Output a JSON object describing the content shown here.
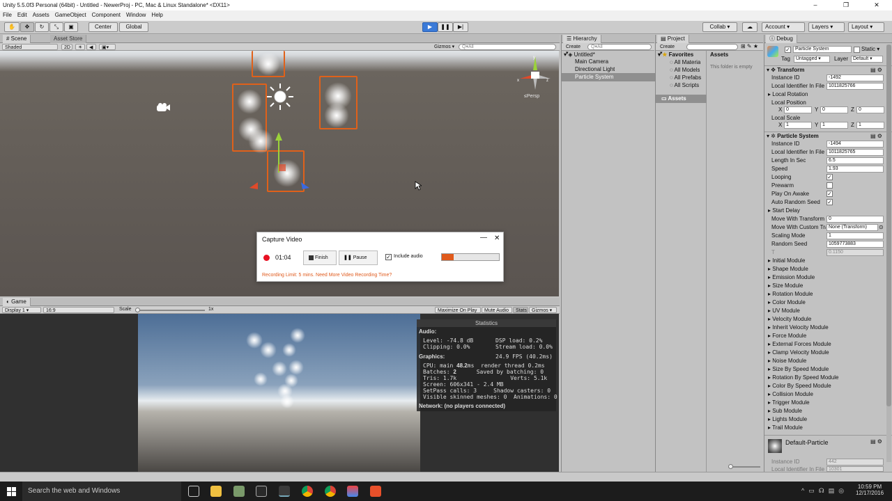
{
  "window": {
    "title": "Unity 5.5.0f3 Personal (64bit) - Untitled - NewerProj - PC, Mac & Linux Standalone* <DX11>",
    "minimize": "–",
    "maximize": "❐",
    "close": "✕"
  },
  "menu": [
    "File",
    "Edit",
    "Assets",
    "GameObject",
    "Component",
    "Window",
    "Help"
  ],
  "toolbar": {
    "center": "Center",
    "global": "Global",
    "collab": "Collab ▾",
    "account": "Account",
    "layers": "Layers",
    "layout": "Layout"
  },
  "scene": {
    "tab_scene": "Scene",
    "tab_store": "Asset Store",
    "shading": "Shaded",
    "mode2d": "2D",
    "gizmos": "Gizmos ▾",
    "search": "Q▾All",
    "persp": "≤Persp"
  },
  "game": {
    "tab": "Game",
    "display": "Display 1",
    "aspect": "16:9",
    "scale_label": "Scale",
    "scale_value": "1x",
    "max_on_play": "Maximize On Play",
    "mute": "Mute Audio",
    "stats": "Stats",
    "gizmos": "Gizmos ▾"
  },
  "stats": {
    "title": "Statistics",
    "audio": "Audio:",
    "level": "Level: -74.8 dB",
    "clipping": "Clipping: 0.0%",
    "dsp": "DSP load: 0.2%",
    "stream": "Stream load: 0.0%",
    "graphics": "Graphics:",
    "fps": "24.9 FPS (40.2ms)",
    "cpu_a": "CPU: main ",
    "cpu_b": "48.2",
    "cpu_c": "ms  render thread 0.2ms",
    "batches_a": "Batches: ",
    "batches_b": "2",
    "batches_c": "      Saved by batching: 0",
    "tris": "Tris: 1.7k                Verts: 5.1k",
    "screen": "Screen: 606x341 - 2.4 MB",
    "setpass": "SetPass calls: 3     Shadow casters: 0",
    "skinned": "Visible skinned meshes: 0  Animations: 0",
    "network": "Network: (no players connected)"
  },
  "hierarchy": {
    "tab": "Hierarchy",
    "create": "Create ▾",
    "search": "Q▾All",
    "scene": "Untitled*",
    "items": [
      "Main Camera",
      "Directional Light",
      "Particle System"
    ]
  },
  "project": {
    "tab": "Project",
    "create": "Create ▾",
    "favorites": "Favorites",
    "fav_items": [
      "All Materia",
      "All Models",
      "All Prefabs",
      "All Scripts"
    ],
    "assets": "Assets",
    "assets_header": "Assets",
    "empty": "This folder is empty"
  },
  "inspector": {
    "tab": "Debug",
    "object_name": "Particle System",
    "static_label": "Static",
    "tag_label": "Tag",
    "tag_value": "Untagged",
    "layer_label": "Layer",
    "layer_value": "Default",
    "transform": {
      "title": "Transform",
      "instance_id_label": "Instance ID",
      "instance_id": "-1492",
      "local_id_label": "Local Identifier In File",
      "local_id": "1011825766",
      "rotation_label": "Local Rotation",
      "position_label": "Local Position",
      "pos": [
        "0",
        "0",
        "0"
      ],
      "scale_label": "Local Scale",
      "scale": [
        "1",
        "1",
        "1"
      ]
    },
    "ps": {
      "title": "Particle System",
      "instance_id_label": "Instance ID",
      "instance_id": "-1494",
      "local_id_label": "Local Identifier In File",
      "local_id": "1011825765",
      "length_label": "Length In Sec",
      "length": "6.5",
      "speed_label": "Speed",
      "speed": "1.93",
      "looping": "Looping",
      "prewarm": "Prewarm",
      "play_on_awake": "Play On Awake",
      "auto_seed": "Auto Random Seed",
      "start_delay": "Start Delay",
      "move_transform_label": "Move With Transform",
      "move_transform": "0",
      "move_custom_label": "Move With Custom Transform",
      "move_custom": "None (Transform)",
      "scaling_label": "Scaling Mode",
      "scaling": "1",
      "random_seed_label": "Random Seed",
      "random_seed": "1059773883",
      "t_label": "T",
      "t_value": "0.1150"
    },
    "modules": [
      "Initial Module",
      "Shape Module",
      "Emission Module",
      "Size Module",
      "Rotation Module",
      "Color Module",
      "UV Module",
      "Velocity Module",
      "Inherit Velocity Module",
      "Force Module",
      "External Forces Module",
      "Clamp Velocity Module",
      "Noise Module",
      "Size By Speed Module",
      "Rotation By Speed Module",
      "Color By Speed Module",
      "Collision Module",
      "Trigger Module",
      "Sub Module",
      "Lights Module",
      "Trail Module"
    ],
    "material": "Default-Particle",
    "mat_instance_label": "Instance ID",
    "mat_instance": "442",
    "mat_local_label": "Local Identifier In File",
    "mat_local": "10301"
  },
  "capture": {
    "title": "Capture Video",
    "time": "01:04",
    "finish": "Finish",
    "pause": "Pause",
    "include_audio": "Include audio",
    "limit": "Recording Limit: 5 mins. Need More Video Recording Time?",
    "progress": 0.21
  },
  "taskbar": {
    "search": "Search the web and Windows",
    "time": "10:59 PM",
    "date": "12/17/2016"
  },
  "colors": {
    "selection": "#e0611a",
    "record": "#e81123",
    "link": "#e05a1c"
  }
}
